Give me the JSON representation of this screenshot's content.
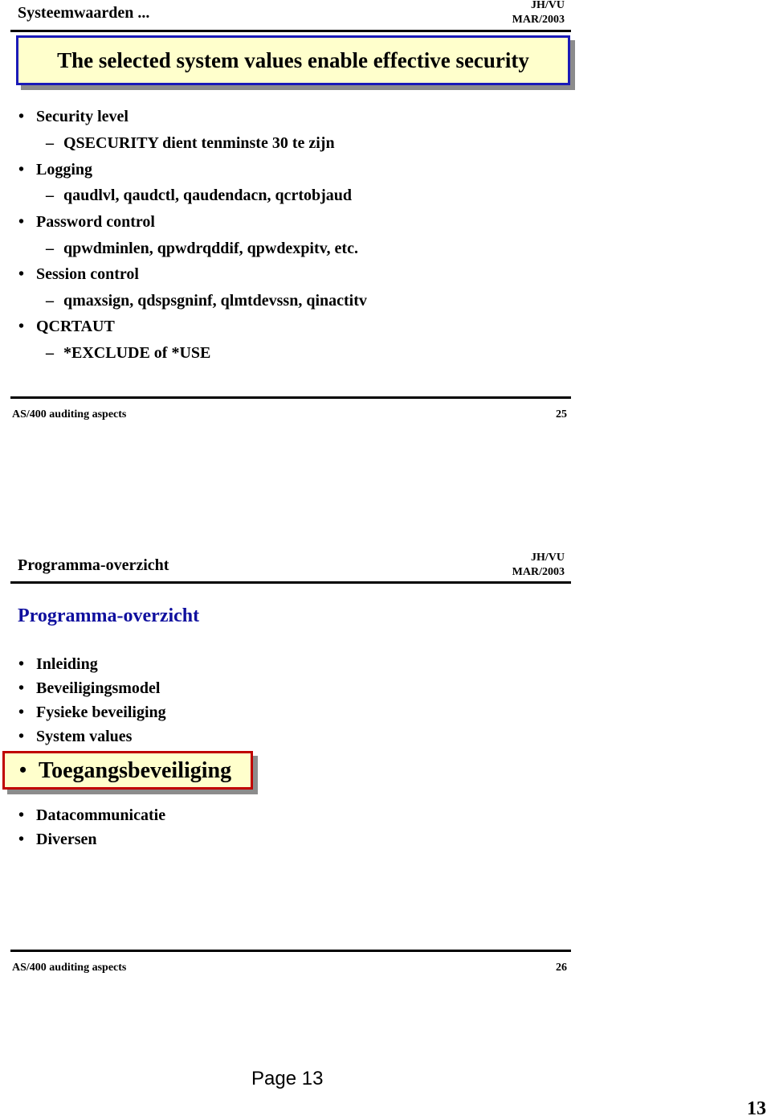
{
  "slide1": {
    "header_title": "Systeemwaarden ...",
    "author": "JH/VU",
    "date": "MAR/2003",
    "title_box": "The selected system values enable effective  security",
    "items": [
      {
        "bullet": "•",
        "label": "Security level",
        "sub": "QSECURITY dient tenminste 30 te zijn"
      },
      {
        "bullet": "•",
        "label": "Logging",
        "sub": "qaudlvl, qaudctl, qaudendacn, qcrtobjaud"
      },
      {
        "bullet": "•",
        "label": "Password control",
        "sub": "qpwdminlen, qpwdrqddif, qpwdexpitv, etc."
      },
      {
        "bullet": "•",
        "label": "Session control",
        "sub": "qmaxsign, qdspsgninf, qlmtdevssn, qinactitv"
      },
      {
        "bullet": "•",
        "label": "QCRTAUT",
        "sub": "*EXCLUDE of *USE"
      }
    ],
    "sub_marker": "–",
    "footer_left": "AS/400 auditing aspects",
    "footer_page": "25"
  },
  "slide2": {
    "header_title": "Programma-overzicht",
    "author": "JH/VU",
    "date": "MAR/2003",
    "heading": "Programma-overzicht",
    "items_before": [
      "Inleiding",
      "Beveiligingsmodel",
      "Fysieke beveiliging",
      "System values"
    ],
    "highlighted_item": "Toegangsbeveiliging",
    "items_after": [
      "Datacommunicatie",
      "Diversen"
    ],
    "bullet": "•",
    "footer_left": "AS/400 auditing aspects",
    "footer_page": "26"
  },
  "page": {
    "label": "Page 13",
    "number": "13"
  },
  "colors": {
    "title_box_fill": "#ffffcc",
    "title_box_border": "#1a1ab8",
    "highlight_border": "#c00000",
    "heading_blue": "#0f0f9e",
    "shadow": "#8c8c8c"
  }
}
